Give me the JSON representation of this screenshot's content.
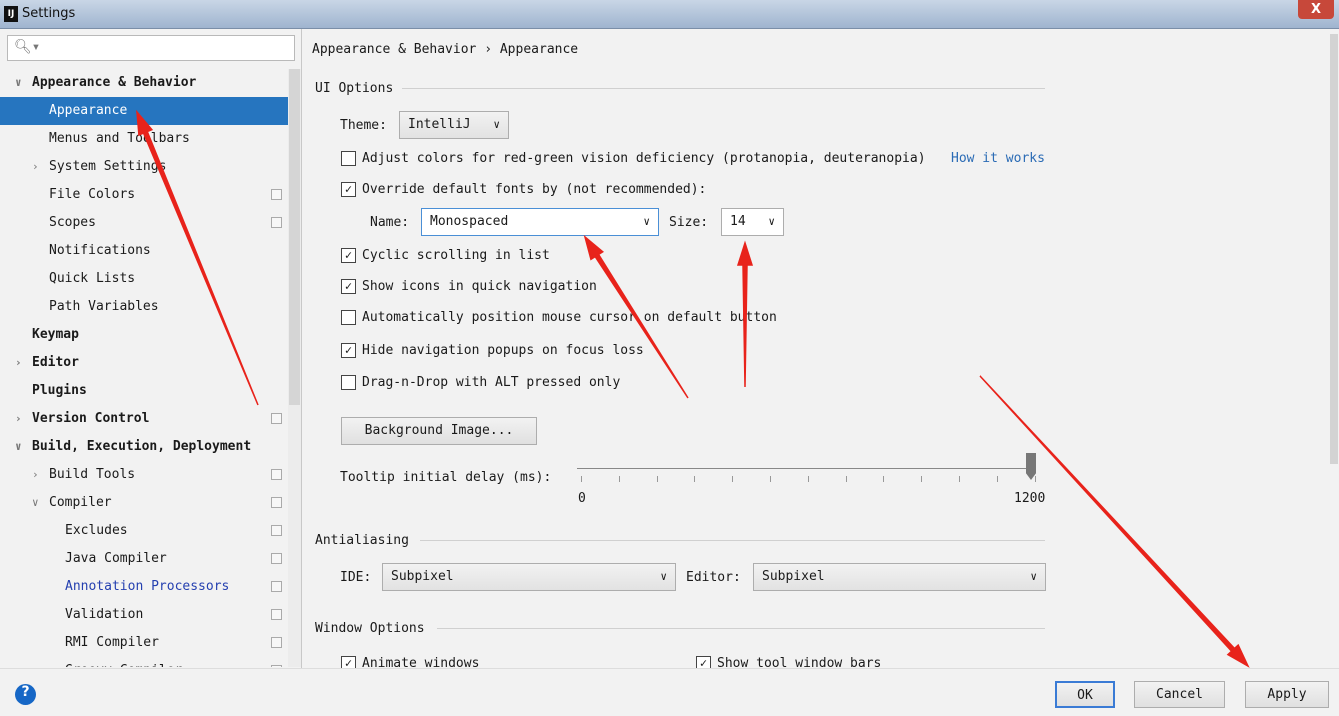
{
  "window": {
    "title": "Settings",
    "logo": "IJ",
    "close": "X"
  },
  "search": {
    "value": "",
    "icon": "search-icon"
  },
  "tree": [
    {
      "label": "Appearance & Behavior",
      "level": 0,
      "bold": true,
      "arrow": "down"
    },
    {
      "label": "Appearance",
      "level": 1,
      "selected": true
    },
    {
      "label": "Menus and Toolbars",
      "level": 1
    },
    {
      "label": "System Settings",
      "level": 1,
      "arrow": "right"
    },
    {
      "label": "File Colors",
      "level": 1,
      "copy": true
    },
    {
      "label": "Scopes",
      "level": 1,
      "copy": true
    },
    {
      "label": "Notifications",
      "level": 1
    },
    {
      "label": "Quick Lists",
      "level": 1
    },
    {
      "label": "Path Variables",
      "level": 1
    },
    {
      "label": "Keymap",
      "level": 0,
      "bold": true
    },
    {
      "label": "Editor",
      "level": 0,
      "bold": true,
      "arrow": "right"
    },
    {
      "label": "Plugins",
      "level": 0,
      "bold": true
    },
    {
      "label": "Version Control",
      "level": 0,
      "bold": true,
      "arrow": "right",
      "copy": true
    },
    {
      "label": "Build, Execution, Deployment",
      "level": 0,
      "bold": true,
      "arrow": "down"
    },
    {
      "label": "Build Tools",
      "level": 1,
      "arrow": "right",
      "copy": true
    },
    {
      "label": "Compiler",
      "level": 1,
      "arrow": "down",
      "copy": true
    },
    {
      "label": "Excludes",
      "level": 2,
      "copy": true
    },
    {
      "label": "Java Compiler",
      "level": 2,
      "copy": true
    },
    {
      "label": "Annotation Processors",
      "level": 2,
      "copy": true,
      "link": true
    },
    {
      "label": "Validation",
      "level": 2,
      "copy": true
    },
    {
      "label": "RMI Compiler",
      "level": 2,
      "copy": true
    },
    {
      "label": "Groovy Compiler",
      "level": 2,
      "copy": true
    }
  ],
  "breadcrumb": {
    "parent": "Appearance & Behavior",
    "sep": "›",
    "current": "Appearance"
  },
  "ui_options": {
    "heading": "UI Options",
    "theme_label": "Theme:",
    "theme_value": "IntelliJ",
    "adjust_colors": {
      "label": "Adjust colors for red-green vision deficiency (protanopia, deuteranopia)",
      "checked": false,
      "link": "How it works"
    },
    "override_fonts": {
      "label": "Override default fonts by (not recommended):",
      "checked": true
    },
    "name_label": "Name:",
    "name_value": "Monospaced",
    "size_label": "Size:",
    "size_value": "14",
    "cyclic": {
      "label": "Cyclic scrolling in list",
      "checked": true
    },
    "show_icons": {
      "label": "Show icons in quick navigation",
      "checked": true
    },
    "auto_position": {
      "label": "Automatically position mouse cursor on default button",
      "checked": false
    },
    "hide_nav": {
      "label": "Hide navigation popups on focus loss",
      "checked": true
    },
    "dnd": {
      "label": "Drag-n-Drop with ALT pressed only",
      "checked": false
    },
    "bg_image_button": "Background Image...",
    "tooltip_label": "Tooltip initial delay (ms):",
    "tooltip_min": "0",
    "tooltip_max": "1200",
    "tooltip_value": 1200
  },
  "antialiasing": {
    "heading": "Antialiasing",
    "ide_label": "IDE:",
    "ide_value": "Subpixel",
    "editor_label": "Editor:",
    "editor_value": "Subpixel"
  },
  "window_options": {
    "heading": "Window Options",
    "animate": {
      "label": "Animate windows",
      "checked": true
    },
    "toolbars": {
      "label": "Show tool window bars",
      "checked": true
    }
  },
  "buttons": {
    "ok": "OK",
    "cancel": "Cancel",
    "apply": "Apply",
    "help": "?"
  },
  "annotation_color": "#e8231b"
}
